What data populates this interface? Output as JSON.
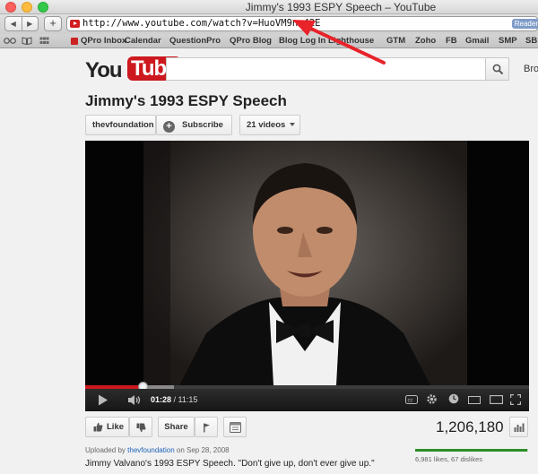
{
  "window": {
    "title": "Jimmy's 1993 ESPY Speech – YouTube"
  },
  "toolbar": {
    "back": "◀",
    "forward": "▶",
    "new_tab": "+",
    "url": "http://www.youtube.com/watch?v=HuoVM9nm42E",
    "reader": "Reader"
  },
  "bookmarks": {
    "items": [
      "QPro Inbox",
      "Calendar",
      "QuestionPro",
      "QPro Blog",
      "Blog Log In",
      "Lighthouse",
      "GTM",
      "Zoho",
      "FB",
      "Gmail",
      "SMP",
      "SB"
    ]
  },
  "header": {
    "logo_you": "You",
    "logo_tube": "Tube",
    "search_placeholder": "",
    "browse": "Bro"
  },
  "video": {
    "title": "Jimmy's 1993 ESPY Speech",
    "channel": "thevfoundation",
    "subscribe": "Subscribe",
    "videos_count": "21 videos",
    "current_time": "01:28",
    "separator": " / ",
    "duration": "11:15",
    "progress_played": 0.13,
    "progress_buffered": 0.2
  },
  "actions": {
    "like": "Like",
    "share": "Share",
    "view_count": "1,206,180"
  },
  "meta": {
    "uploaded_prefix": "Uploaded by ",
    "uploader": "thevfoundation",
    "uploaded_suffix": " on Sep 28, 2008",
    "description": "Jimmy Valvano's 1993 ESPY Speech. \"Don't give up, don't ever give up.\"",
    "likes_text": "6,981 likes, 67 dislikes",
    "like_ratio": 0.99
  },
  "colors": {
    "youtube_red": "#cc181e",
    "annotation_red": "#e8232a",
    "like_green": "#2b8f28",
    "link_blue": "#1c62b9"
  }
}
